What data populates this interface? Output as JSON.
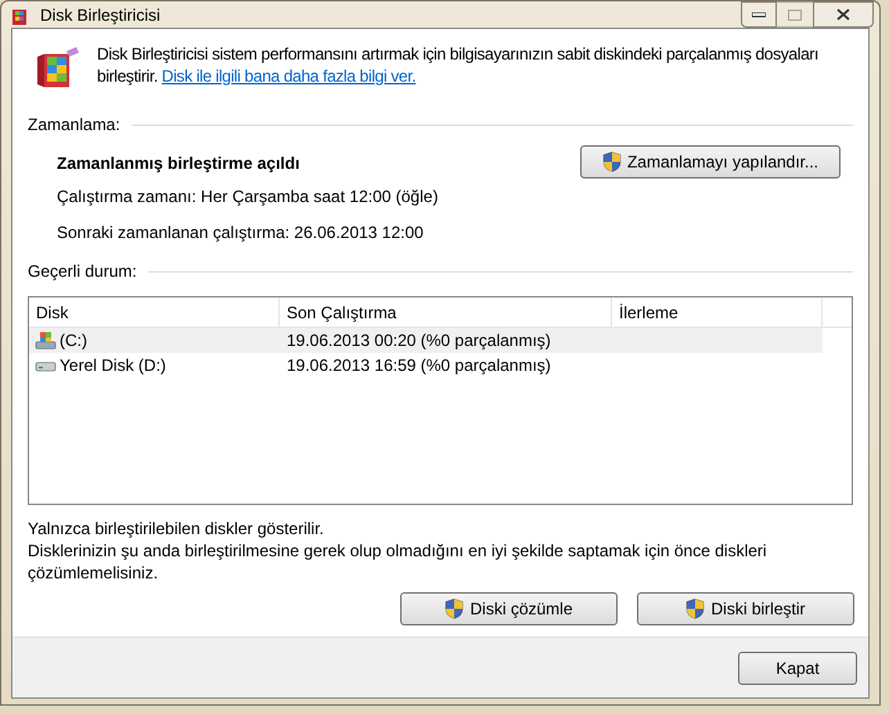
{
  "window": {
    "title": "Disk Birleştiricisi"
  },
  "intro": {
    "text": "Disk Birleştiricisi sistem performansını artırmak için bilgisayarınızın sabit diskindeki parçalanmış dosyaları birleştirir.",
    "link": "Disk ile ilgili bana daha fazla bilgi ver."
  },
  "schedule": {
    "heading": "Zamanlama:",
    "status": "Zamanlanmış birleştirme açıldı",
    "run_time": "Çalıştırma zamanı: Her Çarşamba saat 12:00 (öğle)",
    "next_run": "Sonraki zamanlanan çalıştırma: 26.06.2013 12:00",
    "button": "Zamanlamayı yapılandır..."
  },
  "current_status": {
    "heading": "Geçerli durum:"
  },
  "table": {
    "columns": [
      "Disk",
      "Son Çalıştırma",
      "İlerleme"
    ],
    "rows": [
      {
        "kind": "system",
        "disk": "(C:)",
        "last_run": "19.06.2013 00:20 (%0 parçalanmış)",
        "selected": true
      },
      {
        "kind": "local",
        "disk": "Yerel Disk (D:)",
        "last_run": "19.06.2013 16:59 (%0 parçalanmış)",
        "selected": false
      }
    ]
  },
  "notes": [
    "Yalnızca birleştirilebilen diskler gösterilir.",
    "Disklerinizin şu anda birleştirilmesine gerek olup olmadığını en iyi şekilde saptamak için önce diskleri çözümlemelisiniz."
  ],
  "buttons": [
    "Diski çözümle",
    "Diski birleştir"
  ],
  "footer": {
    "close": "Kapat"
  }
}
